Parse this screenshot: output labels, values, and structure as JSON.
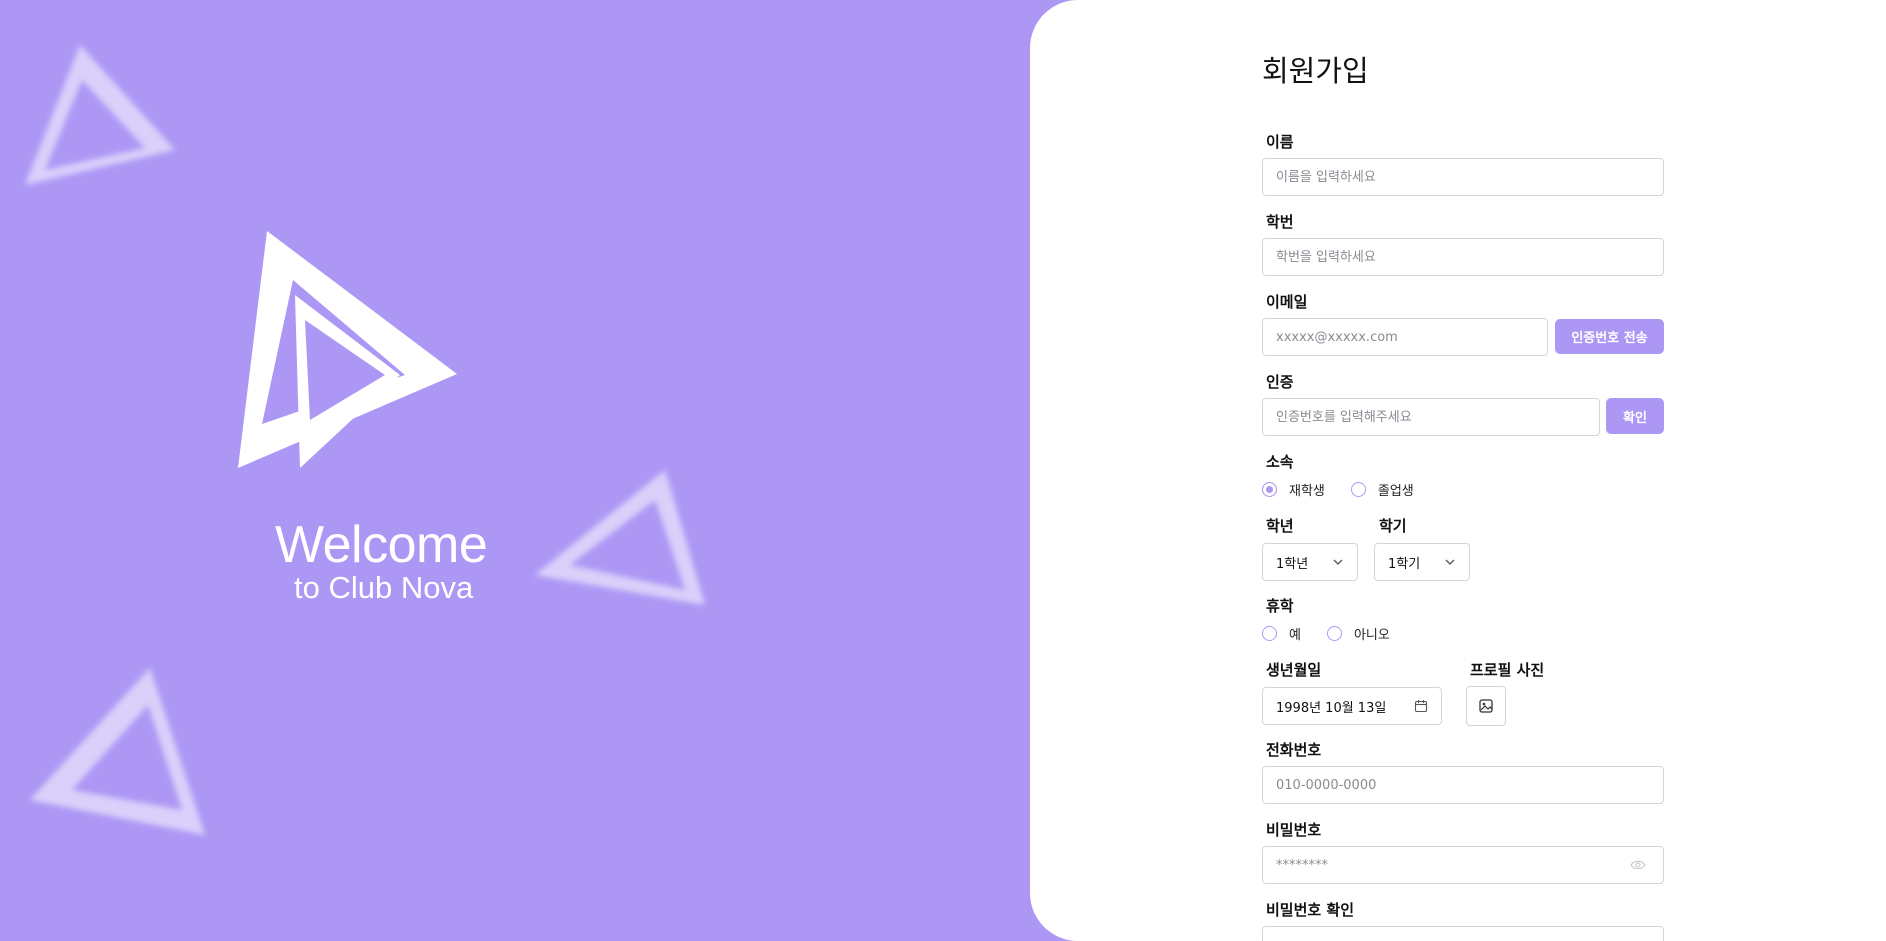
{
  "welcome": {
    "title": "Welcome",
    "subtitle": "to Club Nova"
  },
  "form": {
    "title": "회원가입",
    "name": {
      "label": "이름",
      "placeholder": "이름을 입력하세요"
    },
    "student_id": {
      "label": "학번",
      "placeholder": "학번을 입력하세요"
    },
    "email": {
      "label": "이메일",
      "placeholder": "xxxxx@xxxxx.com",
      "send_button": "인증번호 전송"
    },
    "verify": {
      "label": "인증",
      "placeholder": "인증번호를 입력해주세요",
      "confirm_button": "확인"
    },
    "affiliation": {
      "label": "소속",
      "options": [
        "재학생",
        "졸업생"
      ],
      "selected": "재학생"
    },
    "year": {
      "label": "학년",
      "value": "1학년"
    },
    "semester": {
      "label": "학기",
      "value": "1학기"
    },
    "leave": {
      "label": "휴학",
      "options": [
        "예",
        "아니오"
      ]
    },
    "birthdate": {
      "label": "생년월일",
      "value": "1998년 10월 13일"
    },
    "profile_photo": {
      "label": "프로필 사진"
    },
    "phone": {
      "label": "전화번호",
      "placeholder": "010-0000-0000"
    },
    "password": {
      "label": "비밀번호",
      "placeholder": "********"
    },
    "password_confirm": {
      "label": "비밀번호 확인"
    }
  },
  "colors": {
    "accent": "#AD97F5",
    "background": "#FFFFFF",
    "border": "#D3D3D9"
  },
  "icons": [
    "logo-triangles",
    "chevron-down-icon",
    "calendar-icon",
    "image-icon",
    "eye-icon"
  ]
}
